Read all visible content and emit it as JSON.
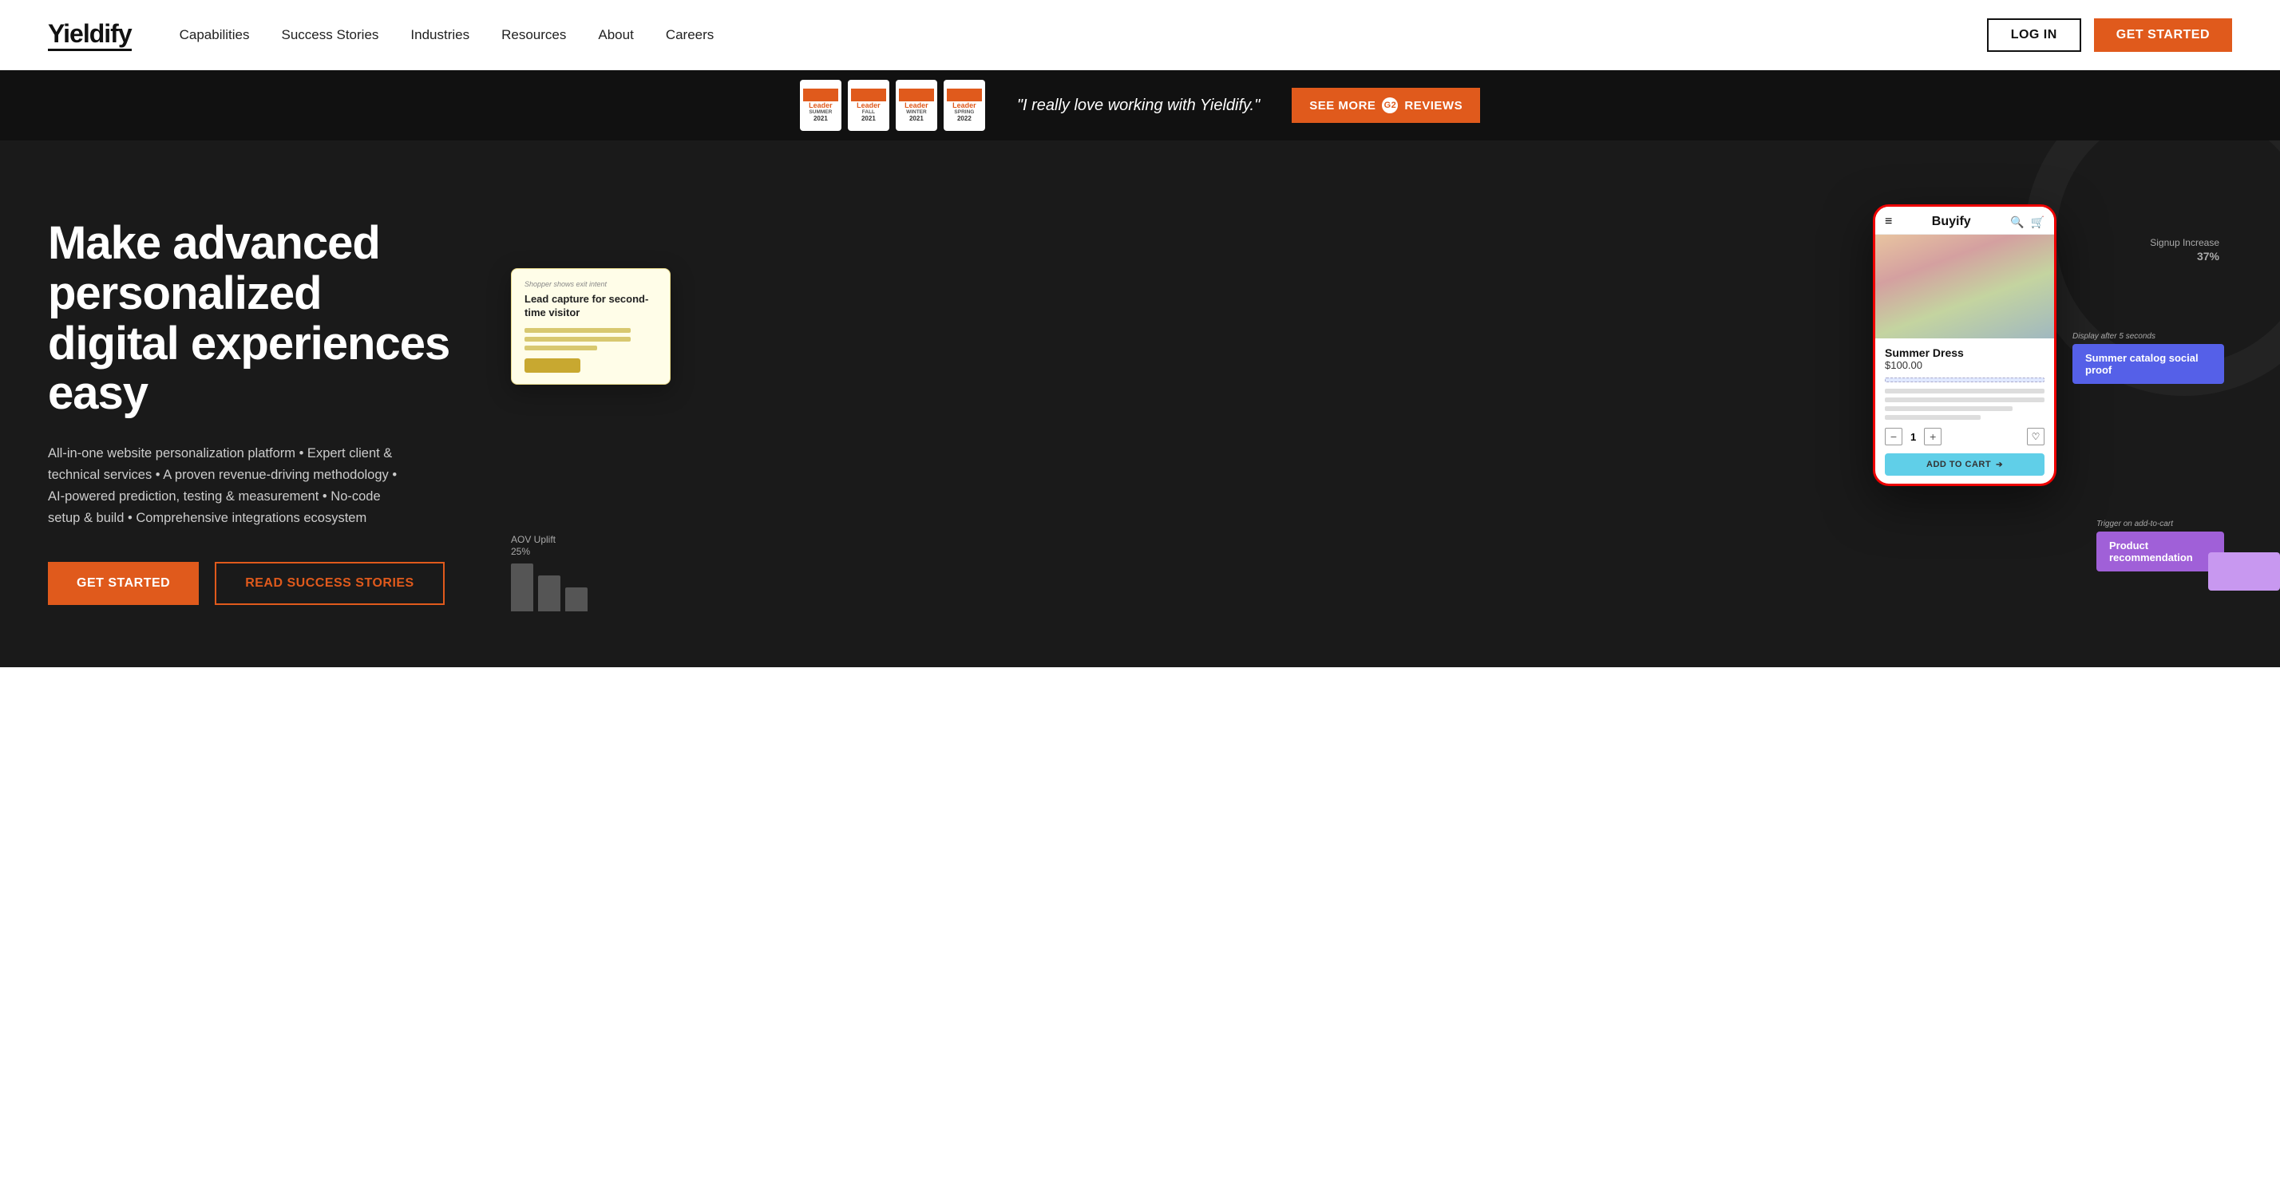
{
  "header": {
    "logo": "Yieldify",
    "nav": {
      "items": [
        {
          "label": "Capabilities",
          "id": "capabilities"
        },
        {
          "label": "Success Stories",
          "id": "success-stories"
        },
        {
          "label": "Industries",
          "id": "industries"
        },
        {
          "label": "Resources",
          "id": "resources"
        },
        {
          "label": "About",
          "id": "about"
        },
        {
          "label": "Careers",
          "id": "careers"
        }
      ]
    },
    "login_label": "LOG IN",
    "get_started_label": "GET STARTED"
  },
  "banner": {
    "quote": "\"I really love working with Yieldify.\"",
    "see_more_label": "SEE MORE",
    "reviews_label": "REVIEWS",
    "badges": [
      {
        "season": "SUMMER",
        "year": "2021"
      },
      {
        "season": "FALL",
        "year": "2021"
      },
      {
        "season": "WINTER",
        "year": "2021"
      },
      {
        "season": "SPRING",
        "year": "2022"
      }
    ]
  },
  "hero": {
    "headline": "Make advanced personalized digital experiences easy",
    "description": "All-in-one website personalization platform • Expert client & technical services • A proven revenue-driving methodology • AI-powered prediction, testing & measurement • No-code setup & build • Comprehensive integrations ecosystem",
    "get_started_label": "GET STARTED",
    "read_stories_label": "READ SUCCESS STORIES"
  },
  "visual": {
    "phone": {
      "brand": "Buyify",
      "product_name": "Summer Dress",
      "product_price": "$100.00",
      "qty": "1",
      "add_to_cart": "ADD TO CART"
    },
    "lead_capture": {
      "trigger_label": "Shopper shows exit intent",
      "title": "Lead capture for second-time visitor"
    },
    "social_proof": {
      "display_label": "Display after 5 seconds",
      "tag": "Summer catalog social proof"
    },
    "product_rec": {
      "trigger_label": "Trigger on add-to-cart",
      "tag": "Product recommendation"
    },
    "signup": {
      "label": "Signup Increase",
      "pct": "37%"
    },
    "aov": {
      "label": "AOV Uplift",
      "pct": "25%"
    }
  }
}
